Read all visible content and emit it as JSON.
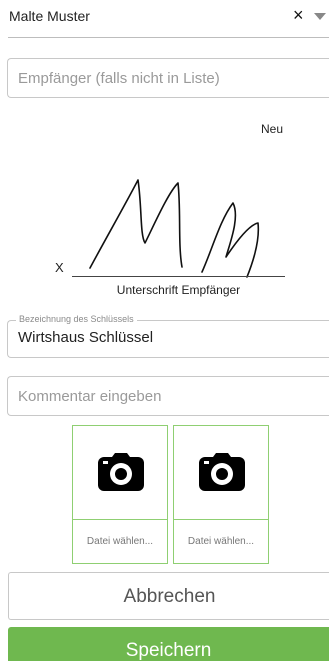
{
  "recipient": {
    "selected": "Malte Muster",
    "clear_symbol": "×"
  },
  "recipient_input": {
    "placeholder": "Empfänger (falls nicht in Liste)"
  },
  "signature": {
    "new_label": "Neu",
    "x_mark": "X",
    "caption": "Unterschrift Empfänger"
  },
  "key_field": {
    "label": "Bezeichnung des Schlüssels",
    "value": "Wirtshaus Schlüssel"
  },
  "comment_input": {
    "placeholder": "Kommentar eingeben"
  },
  "photos": [
    {
      "icon": "camera-icon",
      "choose_label": "Datei wählen..."
    },
    {
      "icon": "camera-icon",
      "choose_label": "Datei wählen..."
    }
  ],
  "buttons": {
    "cancel_label": "Abbrechen",
    "save_label": "Speichern"
  },
  "colors": {
    "accent_green": "#6fb84f",
    "slot_border": "#8fcf72",
    "field_border": "#c8c8c8"
  }
}
